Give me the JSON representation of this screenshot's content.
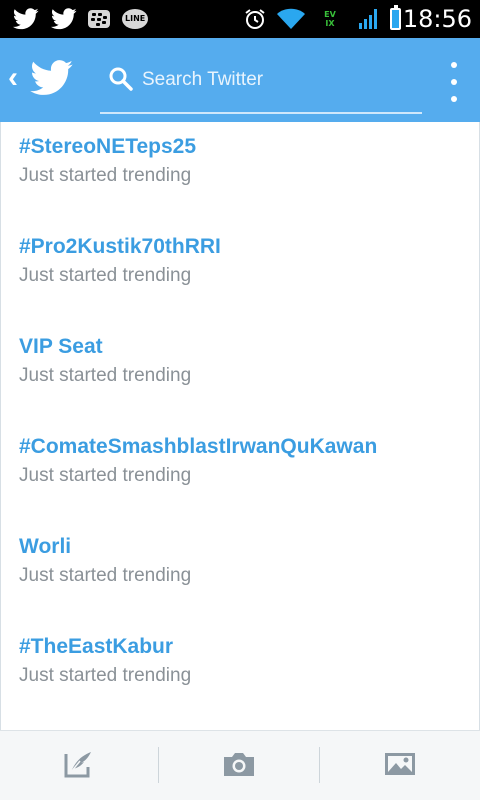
{
  "status_bar": {
    "time": "18:56",
    "icons": [
      "twitter-notification-icon",
      "twitter-notification-icon",
      "bbm-icon",
      "line-icon",
      "alarm-icon",
      "wifi-icon",
      "data-icon",
      "signal-icon",
      "battery-charging-icon"
    ],
    "line_label": "LINE",
    "ev_label": "EV",
    "ix_label": "IX"
  },
  "action_bar": {
    "back_glyph": "‹",
    "search_placeholder": "Search Twitter",
    "color": "#55acee"
  },
  "trends": [
    {
      "name": "#StereoNETeps25",
      "subtitle": "Just started trending"
    },
    {
      "name": "#Pro2Kustik70thRRI",
      "subtitle": "Just started trending"
    },
    {
      "name": "VIP Seat",
      "subtitle": "Just started trending"
    },
    {
      "name": "#ComateSmashblastIrwanQuKawan",
      "subtitle": "Just started trending"
    },
    {
      "name": "Worli",
      "subtitle": "Just started trending"
    },
    {
      "name": "#TheEastKabur",
      "subtitle": "Just started trending"
    }
  ],
  "bottom_toolbar": {
    "buttons": [
      "compose-tweet-icon",
      "camera-icon",
      "image-gallery-icon"
    ]
  },
  "colors": {
    "accent": "#55acee",
    "trend_text": "#3b9de1",
    "subtitle_text": "#8a9197"
  }
}
